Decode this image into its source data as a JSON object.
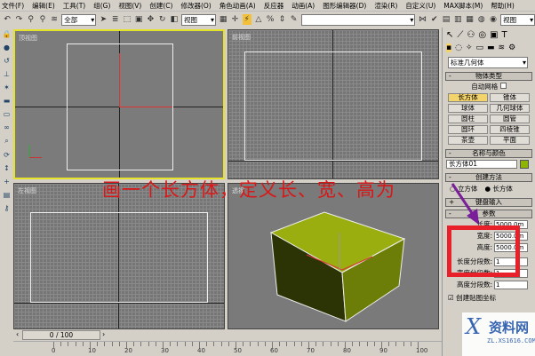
{
  "menu": [
    "文件(F)",
    "编辑(E)",
    "工具(T)",
    "组(G)",
    "视图(V)",
    "创建(C)",
    "修改器(O)",
    "角色动画(A)",
    "反应器",
    "动画(A)",
    "图形编辑器(D)",
    "渲染(R)",
    "自定义(U)",
    "MAX脚本(M)",
    "帮助(H)"
  ],
  "toolbar": {
    "selection_filter": "全部",
    "coord_system": "视图",
    "named_selection": "",
    "render_view": "视图"
  },
  "viewports": {
    "top": "顶视图",
    "front": "前视图",
    "left": "左视图",
    "perspective": "透视"
  },
  "annotation": "画一个长方体，定义长、宽、高为",
  "panel": {
    "category": "标准几何体",
    "object_type": {
      "header": "物体类型",
      "autogrid": "自动网格",
      "buttons": [
        "长方体",
        "锥体",
        "球体",
        "几何球体",
        "圆柱",
        "圆管",
        "圆环",
        "四棱锥",
        "茶壶",
        "平面"
      ],
      "active": "长方体"
    },
    "name_color": {
      "header": "名称与颜色",
      "name": "长方体01",
      "color": "#8db400"
    },
    "creation_method": {
      "header": "创建方法",
      "options": [
        "立方体",
        "长方体"
      ],
      "selected": "长方体"
    },
    "keyboard_entry": {
      "header": "键盘输入"
    },
    "parameters": {
      "header": "参数",
      "length_label": "长度:",
      "length": "5000.0m",
      "width_label": "宽度:",
      "width": "5000.0m",
      "height_label": "高度:",
      "height": "5000.0m",
      "length_segs_label": "长度分段数:",
      "length_segs": "1",
      "width_segs_label": "宽度分段数:",
      "width_segs": "1",
      "height_segs_label": "高度分段数:",
      "height_segs": "1",
      "mapping_label": "创建贴图坐标",
      "mapping_checked": true
    }
  },
  "timeline": {
    "position": "0 / 100",
    "ticks": [
      "0",
      "10",
      "20",
      "30",
      "40",
      "50",
      "60",
      "70",
      "80",
      "90",
      "100"
    ]
  },
  "watermark": {
    "text": "资料网",
    "url": "ZL.XS1616.COM"
  },
  "colors": {
    "box": "#8ea000",
    "annotation": "#d81818",
    "highlight": "#e8202a",
    "arrow": "#7a1f9a"
  }
}
